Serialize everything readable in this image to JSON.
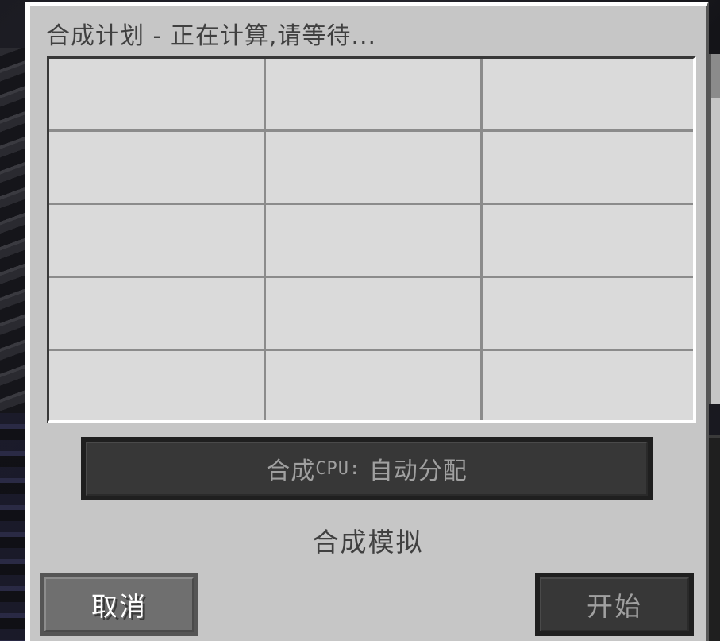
{
  "window": {
    "title": "合成计划 - 正在计算,请等待..."
  },
  "grid": {
    "rows": 5,
    "columns": 3,
    "cells": []
  },
  "cpu_button": {
    "prefix": "合成",
    "cpu_text": "CPU:",
    "suffix": " 自动分配"
  },
  "simulate_label": "合成模拟",
  "buttons": {
    "cancel_label": "取消",
    "start_label": "开始"
  },
  "colors": {
    "panel_bg": "#c6c6c6",
    "cell_bg": "#dadada",
    "grid_line": "#8b8b8b",
    "dark_button": "#373737",
    "text_dark": "#404040",
    "text_disabled": "#a0a0a0"
  }
}
